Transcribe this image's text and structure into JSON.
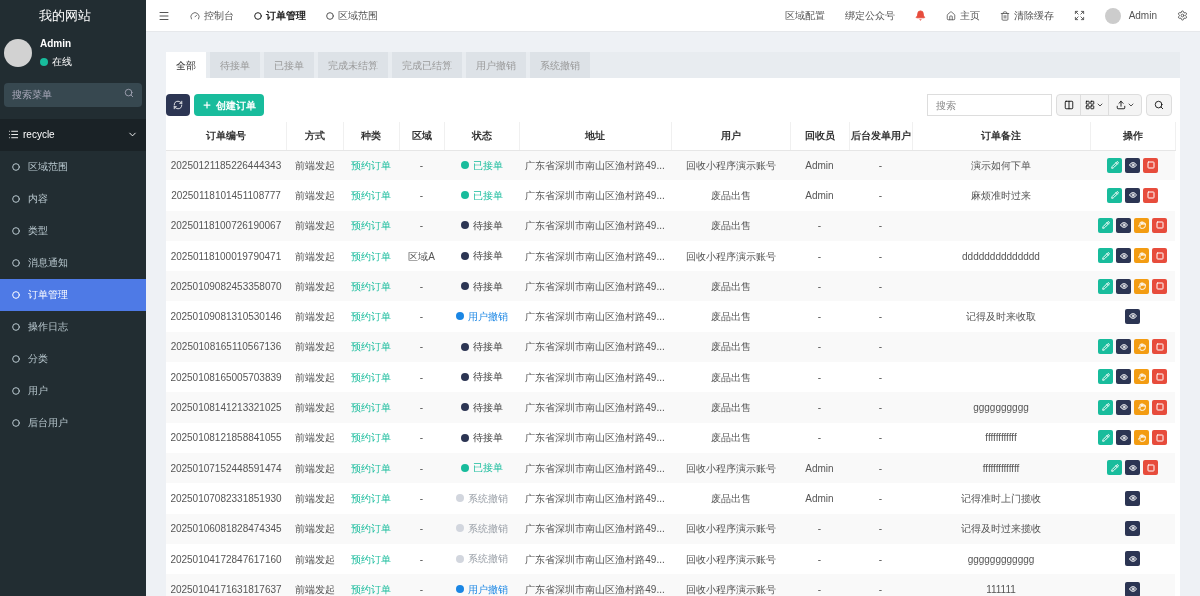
{
  "site_title": "我的网站",
  "user": {
    "name": "Admin",
    "status": "在线",
    "online": true
  },
  "menu_search": {
    "placeholder": "搜索菜单"
  },
  "menu": {
    "group": "recycle",
    "expanded": true,
    "items": [
      {
        "label": "区域范围",
        "selected": false
      },
      {
        "label": "内容",
        "selected": false
      },
      {
        "label": "类型",
        "selected": false
      },
      {
        "label": "消息通知",
        "selected": false
      },
      {
        "label": "订单管理",
        "selected": true
      },
      {
        "label": "操作日志",
        "selected": false
      },
      {
        "label": "分类",
        "selected": false
      },
      {
        "label": "用户",
        "selected": false
      },
      {
        "label": "后台用户",
        "selected": false
      }
    ]
  },
  "topnav": {
    "pages": [
      {
        "kind": "dashboard",
        "label": "控制台",
        "selected": false
      },
      {
        "kind": "page",
        "label": "订单管理",
        "selected": true
      },
      {
        "kind": "page",
        "label": "区域范围",
        "selected": false
      }
    ],
    "links": [
      {
        "kind": "text",
        "label": "区域配置"
      },
      {
        "kind": "text",
        "label": "绑定公众号"
      },
      {
        "kind": "bell"
      },
      {
        "kind": "home",
        "label": "主页"
      },
      {
        "kind": "trash",
        "label": "清除缓存"
      },
      {
        "kind": "fullscreen"
      },
      {
        "kind": "user",
        "label": "Admin"
      },
      {
        "kind": "settings"
      }
    ]
  },
  "tabs": [
    {
      "label": "全部",
      "selected": true
    },
    {
      "label": "待接单",
      "selected": false
    },
    {
      "label": "已接单",
      "selected": false
    },
    {
      "label": "完成未结算",
      "selected": false
    },
    {
      "label": "完成已结算",
      "selected": false
    },
    {
      "label": "用户撤销",
      "selected": false
    },
    {
      "label": "系统撤销",
      "selected": false
    }
  ],
  "toolbar": {
    "create_button": "创建订单",
    "search": {
      "placeholder": "搜索"
    }
  },
  "table": {
    "columns": [
      "订单编号",
      "方式",
      "种类",
      "区域",
      "状态",
      "地址",
      "用户",
      "回收员",
      "后台发单用户",
      "订单备注",
      "操作"
    ],
    "rows": [
      {
        "id": "20250121185226444343",
        "method": "前端发起",
        "type": "预约订单",
        "region": "-",
        "status": {
          "kind": "accepted",
          "label": "已接单"
        },
        "address": "广东省深圳市南山区渔村路49...",
        "user": "回收小程序演示账号",
        "collector": "Admin",
        "backend_user": "-",
        "note": "演示如何下单",
        "actions": [
          {
            "kind": "edit"
          },
          {
            "kind": "view"
          },
          {
            "kind": "delete"
          }
        ]
      },
      {
        "id": "20250118101451108777",
        "method": "前端发起",
        "type": "预约订单",
        "region": "-",
        "status": {
          "kind": "accepted",
          "label": "已接单"
        },
        "address": "广东省深圳市南山区渔村路49...",
        "user": "废品出售",
        "collector": "Admin",
        "backend_user": "-",
        "note": "麻烦准时过来",
        "actions": [
          {
            "kind": "edit"
          },
          {
            "kind": "view"
          },
          {
            "kind": "delete"
          }
        ]
      },
      {
        "id": "20250118100726190067",
        "method": "前端发起",
        "type": "预约订单",
        "region": "-",
        "status": {
          "kind": "pending",
          "label": "待接单"
        },
        "address": "广东省深圳市南山区渔村路49...",
        "user": "废品出售",
        "collector": "-",
        "backend_user": "-",
        "actions": [
          {
            "kind": "edit"
          },
          {
            "kind": "view"
          },
          {
            "kind": "assign"
          },
          {
            "kind": "delete"
          }
        ]
      },
      {
        "id": "20250118100019790471",
        "method": "前端发起",
        "type": "预约订单",
        "region": "区域A",
        "status": {
          "kind": "pending",
          "label": "待接单"
        },
        "address": "广东省深圳市南山区渔村路49...",
        "user": "回收小程序演示账号",
        "collector": "-",
        "backend_user": "-",
        "note": "dddddddddddddd",
        "actions": [
          {
            "kind": "edit"
          },
          {
            "kind": "view"
          },
          {
            "kind": "assign"
          },
          {
            "kind": "delete"
          }
        ]
      },
      {
        "id": "20250109082453358070",
        "method": "前端发起",
        "type": "预约订单",
        "region": "-",
        "status": {
          "kind": "pending",
          "label": "待接单"
        },
        "address": "广东省深圳市南山区渔村路49...",
        "user": "废品出售",
        "collector": "-",
        "backend_user": "-",
        "actions": [
          {
            "kind": "edit"
          },
          {
            "kind": "view"
          },
          {
            "kind": "assign"
          },
          {
            "kind": "delete"
          }
        ]
      },
      {
        "id": "20250109081310530146",
        "method": "前端发起",
        "type": "预约订单",
        "region": "-",
        "status": {
          "kind": "user_cancel",
          "label": "用户撤销"
        },
        "address": "广东省深圳市南山区渔村路49...",
        "user": "废品出售",
        "collector": "-",
        "backend_user": "-",
        "note": "记得及时来收取",
        "actions": [
          {
            "kind": "view"
          }
        ]
      },
      {
        "id": "20250108165110567136",
        "method": "前端发起",
        "type": "预约订单",
        "region": "-",
        "status": {
          "kind": "pending",
          "label": "待接单"
        },
        "address": "广东省深圳市南山区渔村路49...",
        "user": "废品出售",
        "collector": "-",
        "backend_user": "-",
        "actions": [
          {
            "kind": "edit"
          },
          {
            "kind": "view"
          },
          {
            "kind": "assign"
          },
          {
            "kind": "delete"
          }
        ]
      },
      {
        "id": "20250108165005703839",
        "method": "前端发起",
        "type": "预约订单",
        "region": "-",
        "status": {
          "kind": "pending",
          "label": "待接单"
        },
        "address": "广东省深圳市南山区渔村路49...",
        "user": "废品出售",
        "collector": "-",
        "backend_user": "-",
        "actions": [
          {
            "kind": "edit"
          },
          {
            "kind": "view"
          },
          {
            "kind": "assign"
          },
          {
            "kind": "delete"
          }
        ]
      },
      {
        "id": "20250108141213321025",
        "method": "前端发起",
        "type": "预约订单",
        "region": "-",
        "status": {
          "kind": "pending",
          "label": "待接单"
        },
        "address": "广东省深圳市南山区渔村路49...",
        "user": "废品出售",
        "collector": "-",
        "backend_user": "-",
        "note": "gggggggggg",
        "actions": [
          {
            "kind": "edit"
          },
          {
            "kind": "view"
          },
          {
            "kind": "assign"
          },
          {
            "kind": "delete"
          }
        ]
      },
      {
        "id": "20250108121858841055",
        "method": "前端发起",
        "type": "预约订单",
        "region": "-",
        "status": {
          "kind": "pending",
          "label": "待接单"
        },
        "address": "广东省深圳市南山区渔村路49...",
        "user": "废品出售",
        "collector": "-",
        "backend_user": "-",
        "note": "ffffffffffff",
        "actions": [
          {
            "kind": "edit"
          },
          {
            "kind": "view"
          },
          {
            "kind": "assign"
          },
          {
            "kind": "delete"
          }
        ]
      },
      {
        "id": "20250107152448591474",
        "method": "前端发起",
        "type": "预约订单",
        "region": "-",
        "status": {
          "kind": "accepted",
          "label": "已接单"
        },
        "address": "广东省深圳市南山区渔村路49...",
        "user": "回收小程序演示账号",
        "collector": "Admin",
        "backend_user": "-",
        "note": "ffffffffffffff",
        "actions": [
          {
            "kind": "edit"
          },
          {
            "kind": "view"
          },
          {
            "kind": "delete"
          }
        ]
      },
      {
        "id": "20250107082331851930",
        "method": "前端发起",
        "type": "预约订单",
        "region": "-",
        "status": {
          "kind": "system_cancel",
          "label": "系统撤销"
        },
        "address": "广东省深圳市南山区渔村路49...",
        "user": "废品出售",
        "collector": "Admin",
        "backend_user": "-",
        "note": "记得准时上门揽收",
        "actions": [
          {
            "kind": "view"
          }
        ]
      },
      {
        "id": "20250106081828474345",
        "method": "前端发起",
        "type": "预约订单",
        "region": "-",
        "status": {
          "kind": "system_cancel",
          "label": "系统撤销"
        },
        "address": "广东省深圳市南山区渔村路49...",
        "user": "回收小程序演示账号",
        "collector": "-",
        "backend_user": "-",
        "note": "记得及时过来揽收",
        "actions": [
          {
            "kind": "view"
          }
        ]
      },
      {
        "id": "20250104172847617160",
        "method": "前端发起",
        "type": "预约订单",
        "region": "-",
        "status": {
          "kind": "system_cancel",
          "label": "系统撤销"
        },
        "address": "广东省深圳市南山区渔村路49...",
        "user": "回收小程序演示账号",
        "collector": "-",
        "backend_user": "-",
        "note": "gggggggggggg",
        "actions": [
          {
            "kind": "view"
          }
        ]
      },
      {
        "id": "20250104171631817637",
        "method": "前端发起",
        "type": "预约订单",
        "region": "-",
        "status": {
          "kind": "user_cancel",
          "label": "用户撤销"
        },
        "address": "广东省深圳市南山区渔村路49...",
        "user": "回收小程序演示账号",
        "collector": "-",
        "backend_user": "-",
        "note": "111111",
        "actions": [
          {
            "kind": "view"
          }
        ]
      }
    ]
  }
}
